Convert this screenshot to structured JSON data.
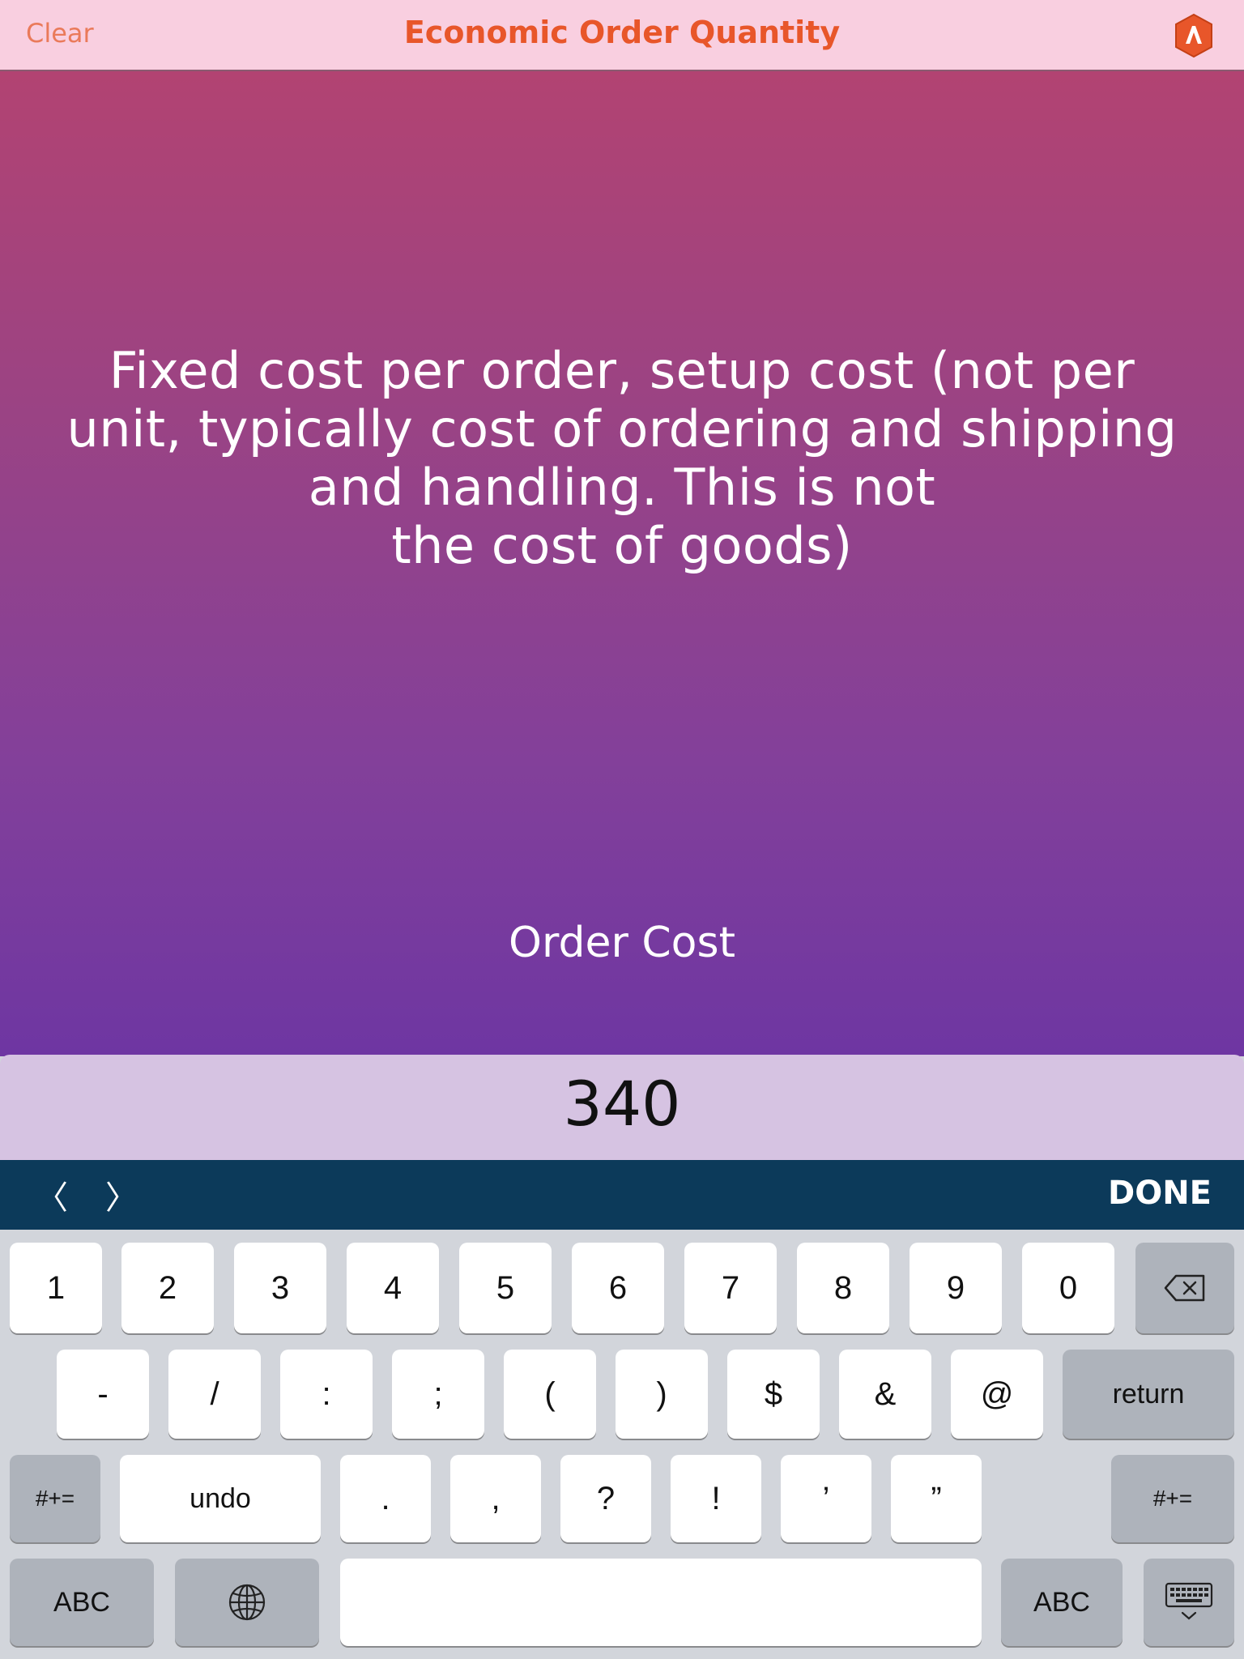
{
  "navbar": {
    "clear_label": "Clear",
    "title": "Economic Order Quantity",
    "logo_icon": "app-logo-icon"
  },
  "main": {
    "hint": "Fixed cost per order, setup cost (not per\nunit, typically cost of ordering and shipping\nand handling.  This is not\nthe cost of goods)",
    "field_label": "Order Cost",
    "field_value": "340"
  },
  "accessory_bar": {
    "prev_label": "〈",
    "next_label": "〉",
    "done_label": "DONE"
  },
  "keyboard": {
    "row1": [
      "1",
      "2",
      "3",
      "4",
      "5",
      "6",
      "7",
      "8",
      "9",
      "0"
    ],
    "delete_icon": "backspace-icon",
    "row2": [
      "-",
      "/",
      ":",
      ";",
      "(",
      ")",
      "$",
      "&",
      "@"
    ],
    "return_label": "return",
    "row3_left": "#+=",
    "undo_label": "undo",
    "row3": [
      ".",
      ",",
      "?",
      "!",
      "’",
      "”"
    ],
    "row3_right": "#+=",
    "abc_left": "ABC",
    "globe_icon": "globe-icon",
    "abc_right": "ABC",
    "dismiss_icon": "keyboard-dismiss-icon"
  },
  "colors": {
    "nav_bg": "#f9cfe0",
    "title": "#e8562a",
    "gradient_top": "#b24372",
    "gradient_bottom": "#6e36a2",
    "input_bg": "#d6c3e2",
    "accessory_bg": "#0c3a5a"
  }
}
